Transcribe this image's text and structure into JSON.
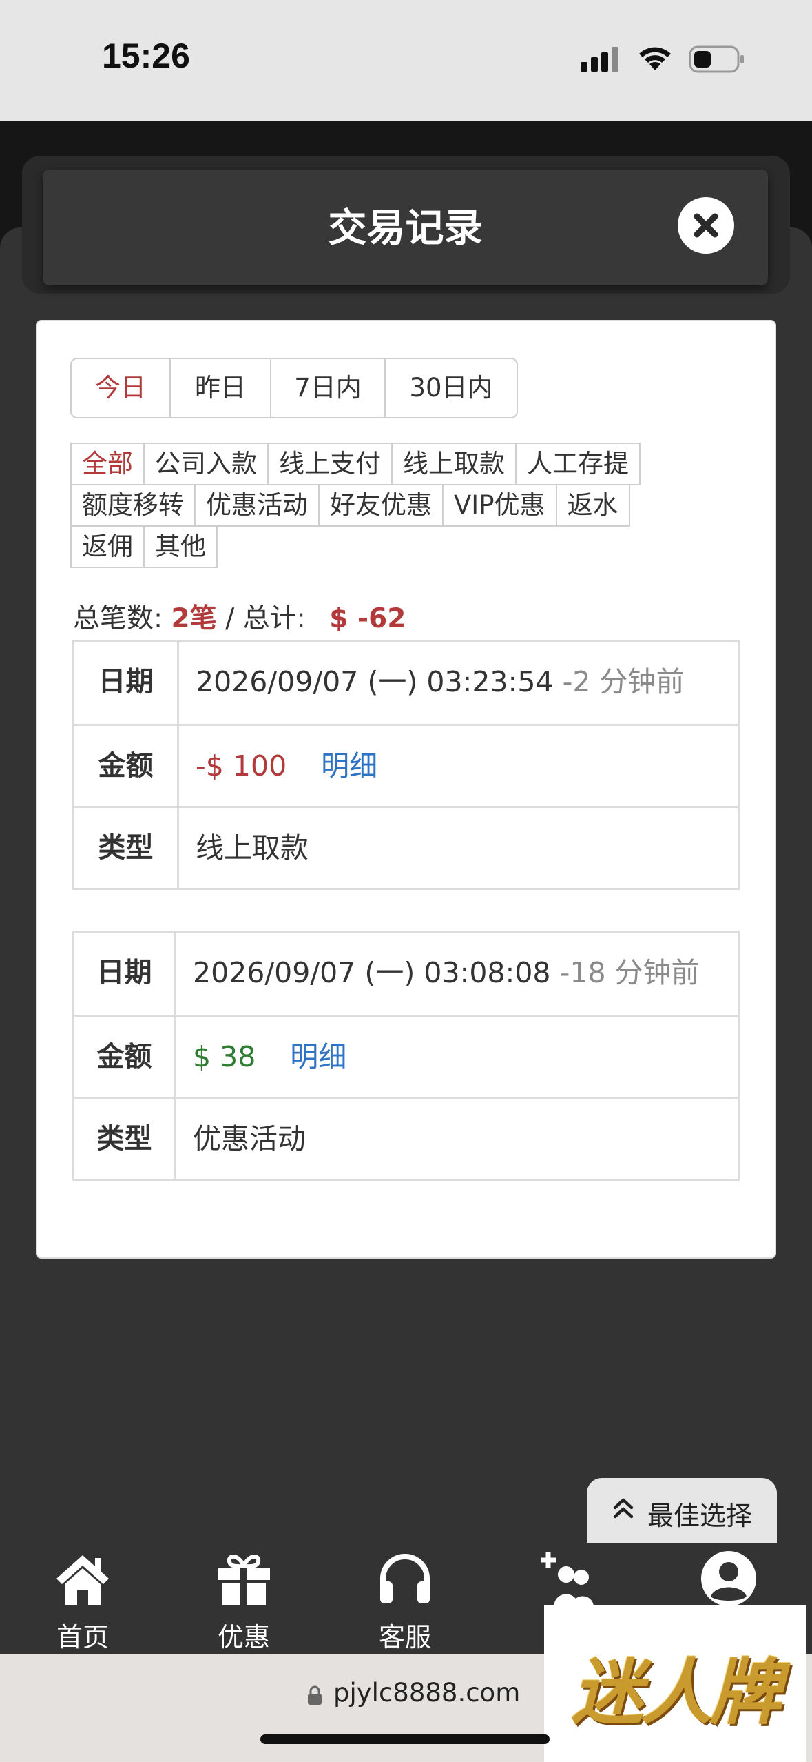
{
  "status_bar": {
    "time": "15:26"
  },
  "modal": {
    "title": "交易记录"
  },
  "date_tabs": [
    "今日",
    "昨日",
    "7日内",
    "30日内"
  ],
  "type_filters": [
    "全部",
    "公司入款",
    "线上支付",
    "线上取款",
    "人工存提",
    "额度移转",
    "优惠活动",
    "好友优惠",
    "VIP优惠",
    "返水",
    "返佣",
    "其他"
  ],
  "summary": {
    "count_label": "总笔数:",
    "count_value": "2笔",
    "separator": " / ",
    "total_label": "总计:",
    "total_value": "$ -62"
  },
  "records": [
    {
      "date_label": "日期",
      "date": "2026/09/07 (一) 03:23:54",
      "ago": "-2 分钟前",
      "amount_label": "金额",
      "amount": "-$ 100",
      "detail_link": "明细",
      "type_label": "类型",
      "type": "线上取款"
    },
    {
      "date_label": "日期",
      "date": "2026/09/07 (一) 03:08:08",
      "ago": "-18 分钟前",
      "amount_label": "金额",
      "amount": "$ 38",
      "detail_link": "明细",
      "type_label": "类型",
      "type": "优惠活动"
    }
  ],
  "best_choice": {
    "label": "最佳选择",
    "icon": "double-chevron-up-icon"
  },
  "bottom_nav": [
    {
      "label": "首页",
      "icon": "home-icon"
    },
    {
      "label": "优惠",
      "icon": "gift-icon"
    },
    {
      "label": "客服",
      "icon": "headset-icon"
    },
    {
      "label": "",
      "icon": "add-friend-icon"
    },
    {
      "label": "",
      "icon": "user-icon"
    }
  ],
  "url_bar": {
    "url": "pjylc8888.com"
  },
  "watermark": {
    "text": "迷人牌"
  },
  "colors": {
    "accent_red": "#b23a3a",
    "positive_green": "#2e7d32",
    "link_blue": "#2f73c4",
    "background": "#333333"
  }
}
